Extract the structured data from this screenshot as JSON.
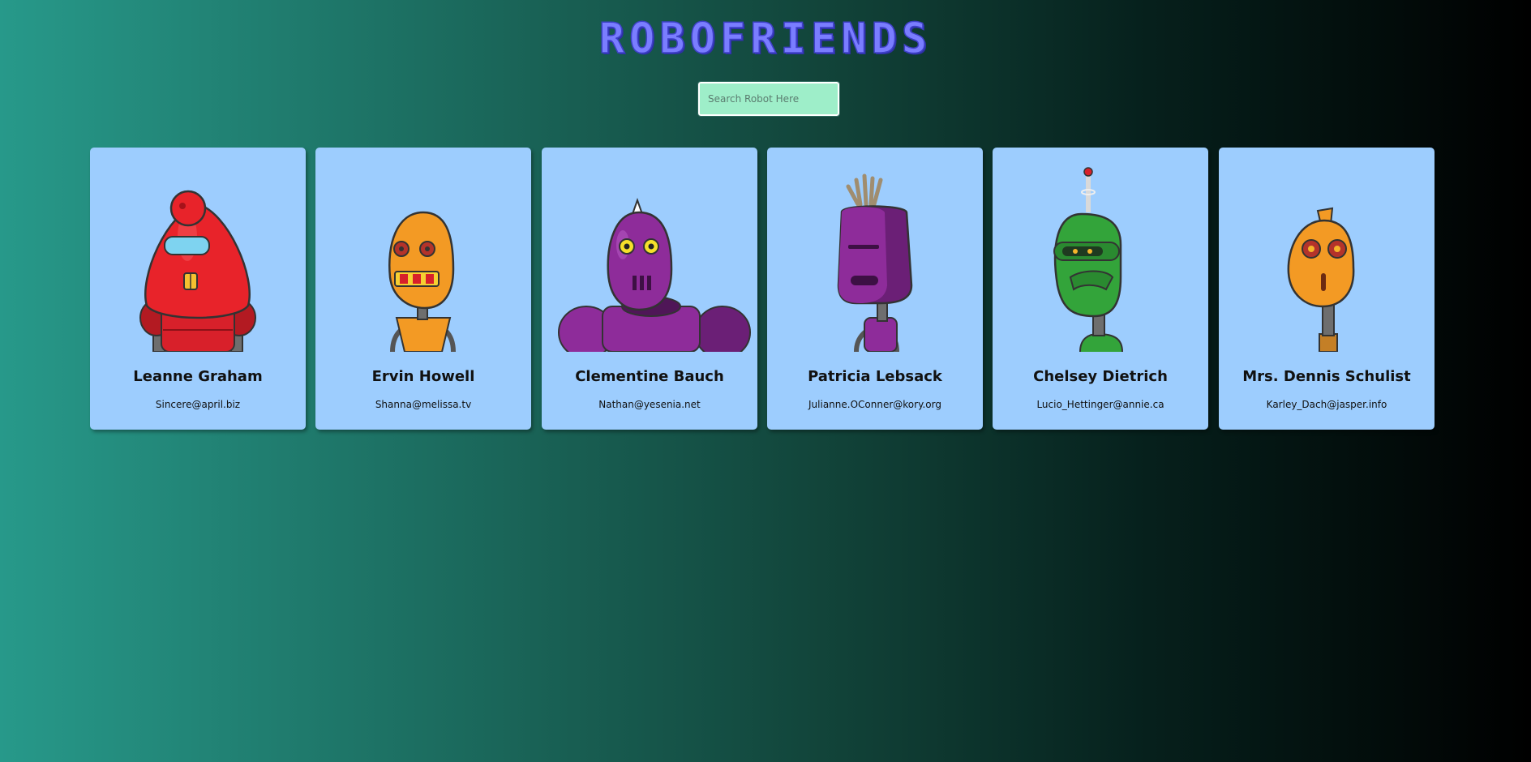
{
  "app": {
    "title": "ROBOFRIENDS"
  },
  "search": {
    "placeholder": "Search Robot Here",
    "value": ""
  },
  "robots": [
    {
      "name": "Leanne Graham",
      "email": "Sincere@april.biz",
      "color": "#e8232a",
      "avatar_icon": "red-robot-avatar"
    },
    {
      "name": "Ervin Howell",
      "email": "Shanna@melissa.tv",
      "color": "#f39a24",
      "avatar_icon": "orange-robot-avatar"
    },
    {
      "name": "Clementine Bauch",
      "email": "Nathan@yesenia.net",
      "color": "#8e2c9a",
      "avatar_icon": "purple-robot-avatar"
    },
    {
      "name": "Patricia Lebsack",
      "email": "Julianne.OConner@kory.org",
      "color": "#8e2c9a",
      "avatar_icon": "purple-robot-avatar"
    },
    {
      "name": "Chelsey Dietrich",
      "email": "Lucio_Hettinger@annie.ca",
      "color": "#33a43a",
      "avatar_icon": "green-robot-avatar"
    },
    {
      "name": "Mrs. Dennis Schulist",
      "email": "Karley_Dach@jasper.info",
      "color": "#f39a24",
      "avatar_icon": "orange-robot-avatar"
    }
  ],
  "colors": {
    "title": "#7a7dff",
    "card_background": "#9dcdfe",
    "search_background": "#9eeec9"
  }
}
